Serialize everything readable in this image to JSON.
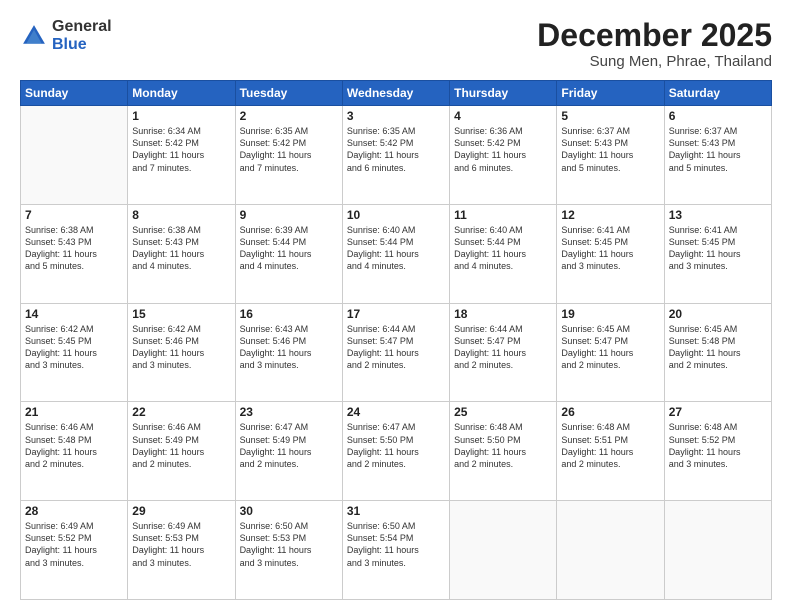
{
  "logo": {
    "general": "General",
    "blue": "Blue"
  },
  "header": {
    "month": "December 2025",
    "location": "Sung Men, Phrae, Thailand"
  },
  "weekdays": [
    "Sunday",
    "Monday",
    "Tuesday",
    "Wednesday",
    "Thursday",
    "Friday",
    "Saturday"
  ],
  "weeks": [
    [
      {
        "day": "",
        "info": ""
      },
      {
        "day": "1",
        "info": "Sunrise: 6:34 AM\nSunset: 5:42 PM\nDaylight: 11 hours\nand 7 minutes."
      },
      {
        "day": "2",
        "info": "Sunrise: 6:35 AM\nSunset: 5:42 PM\nDaylight: 11 hours\nand 7 minutes."
      },
      {
        "day": "3",
        "info": "Sunrise: 6:35 AM\nSunset: 5:42 PM\nDaylight: 11 hours\nand 6 minutes."
      },
      {
        "day": "4",
        "info": "Sunrise: 6:36 AM\nSunset: 5:42 PM\nDaylight: 11 hours\nand 6 minutes."
      },
      {
        "day": "5",
        "info": "Sunrise: 6:37 AM\nSunset: 5:43 PM\nDaylight: 11 hours\nand 5 minutes."
      },
      {
        "day": "6",
        "info": "Sunrise: 6:37 AM\nSunset: 5:43 PM\nDaylight: 11 hours\nand 5 minutes."
      }
    ],
    [
      {
        "day": "7",
        "info": "Sunrise: 6:38 AM\nSunset: 5:43 PM\nDaylight: 11 hours\nand 5 minutes."
      },
      {
        "day": "8",
        "info": "Sunrise: 6:38 AM\nSunset: 5:43 PM\nDaylight: 11 hours\nand 4 minutes."
      },
      {
        "day": "9",
        "info": "Sunrise: 6:39 AM\nSunset: 5:44 PM\nDaylight: 11 hours\nand 4 minutes."
      },
      {
        "day": "10",
        "info": "Sunrise: 6:40 AM\nSunset: 5:44 PM\nDaylight: 11 hours\nand 4 minutes."
      },
      {
        "day": "11",
        "info": "Sunrise: 6:40 AM\nSunset: 5:44 PM\nDaylight: 11 hours\nand 4 minutes."
      },
      {
        "day": "12",
        "info": "Sunrise: 6:41 AM\nSunset: 5:45 PM\nDaylight: 11 hours\nand 3 minutes."
      },
      {
        "day": "13",
        "info": "Sunrise: 6:41 AM\nSunset: 5:45 PM\nDaylight: 11 hours\nand 3 minutes."
      }
    ],
    [
      {
        "day": "14",
        "info": "Sunrise: 6:42 AM\nSunset: 5:45 PM\nDaylight: 11 hours\nand 3 minutes."
      },
      {
        "day": "15",
        "info": "Sunrise: 6:42 AM\nSunset: 5:46 PM\nDaylight: 11 hours\nand 3 minutes."
      },
      {
        "day": "16",
        "info": "Sunrise: 6:43 AM\nSunset: 5:46 PM\nDaylight: 11 hours\nand 3 minutes."
      },
      {
        "day": "17",
        "info": "Sunrise: 6:44 AM\nSunset: 5:47 PM\nDaylight: 11 hours\nand 2 minutes."
      },
      {
        "day": "18",
        "info": "Sunrise: 6:44 AM\nSunset: 5:47 PM\nDaylight: 11 hours\nand 2 minutes."
      },
      {
        "day": "19",
        "info": "Sunrise: 6:45 AM\nSunset: 5:47 PM\nDaylight: 11 hours\nand 2 minutes."
      },
      {
        "day": "20",
        "info": "Sunrise: 6:45 AM\nSunset: 5:48 PM\nDaylight: 11 hours\nand 2 minutes."
      }
    ],
    [
      {
        "day": "21",
        "info": "Sunrise: 6:46 AM\nSunset: 5:48 PM\nDaylight: 11 hours\nand 2 minutes."
      },
      {
        "day": "22",
        "info": "Sunrise: 6:46 AM\nSunset: 5:49 PM\nDaylight: 11 hours\nand 2 minutes."
      },
      {
        "day": "23",
        "info": "Sunrise: 6:47 AM\nSunset: 5:49 PM\nDaylight: 11 hours\nand 2 minutes."
      },
      {
        "day": "24",
        "info": "Sunrise: 6:47 AM\nSunset: 5:50 PM\nDaylight: 11 hours\nand 2 minutes."
      },
      {
        "day": "25",
        "info": "Sunrise: 6:48 AM\nSunset: 5:50 PM\nDaylight: 11 hours\nand 2 minutes."
      },
      {
        "day": "26",
        "info": "Sunrise: 6:48 AM\nSunset: 5:51 PM\nDaylight: 11 hours\nand 2 minutes."
      },
      {
        "day": "27",
        "info": "Sunrise: 6:48 AM\nSunset: 5:52 PM\nDaylight: 11 hours\nand 3 minutes."
      }
    ],
    [
      {
        "day": "28",
        "info": "Sunrise: 6:49 AM\nSunset: 5:52 PM\nDaylight: 11 hours\nand 3 minutes."
      },
      {
        "day": "29",
        "info": "Sunrise: 6:49 AM\nSunset: 5:53 PM\nDaylight: 11 hours\nand 3 minutes."
      },
      {
        "day": "30",
        "info": "Sunrise: 6:50 AM\nSunset: 5:53 PM\nDaylight: 11 hours\nand 3 minutes."
      },
      {
        "day": "31",
        "info": "Sunrise: 6:50 AM\nSunset: 5:54 PM\nDaylight: 11 hours\nand 3 minutes."
      },
      {
        "day": "",
        "info": ""
      },
      {
        "day": "",
        "info": ""
      },
      {
        "day": "",
        "info": ""
      }
    ]
  ]
}
